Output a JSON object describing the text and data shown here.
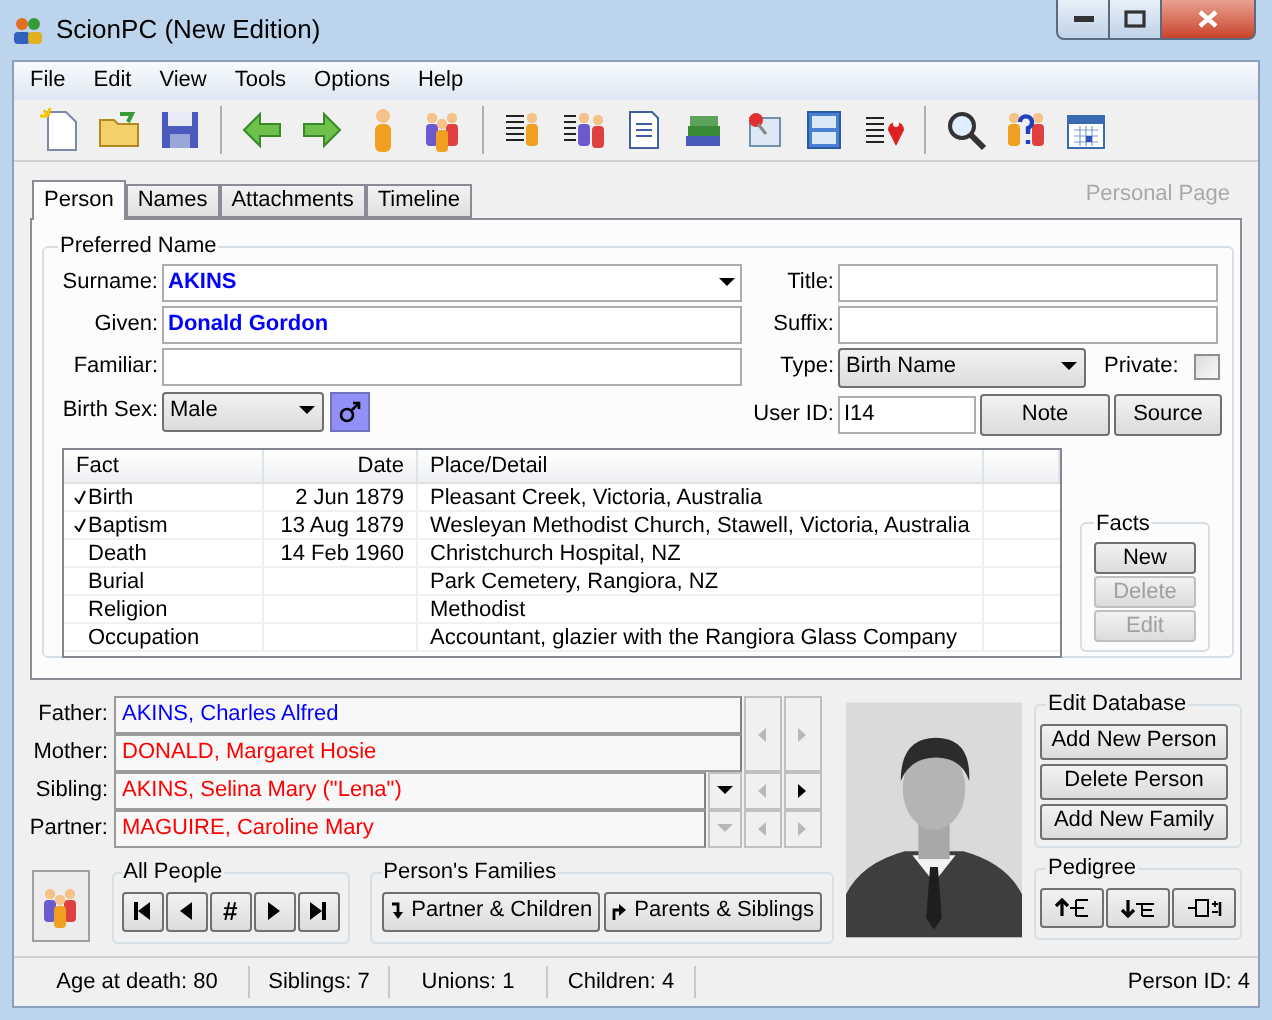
{
  "window": {
    "title": "ScionPC (New Edition)"
  },
  "menu": [
    "File",
    "Edit",
    "View",
    "Tools",
    "Options",
    "Help"
  ],
  "tabs": [
    {
      "label": "Person",
      "selected": true
    },
    {
      "label": "Names",
      "selected": false
    },
    {
      "label": "Attachments",
      "selected": false
    },
    {
      "label": "Timeline",
      "selected": false
    }
  ],
  "page_caption": "Personal Page",
  "preferred_name": {
    "legend": "Preferred Name",
    "surname": {
      "label": "Surname:",
      "value": "AKINS"
    },
    "given": {
      "label": "Given:",
      "value": "Donald Gordon"
    },
    "familiar": {
      "label": "Familiar:"
    },
    "title": {
      "label": "Title:"
    },
    "suffix": {
      "label": "Suffix:"
    },
    "type": {
      "label": "Type:",
      "value": "Birth Name"
    },
    "private": {
      "label": "Private:",
      "checked": false
    },
    "birth_sex": {
      "label": "Birth Sex:",
      "value": "Male"
    },
    "user_id": {
      "label": "User ID:",
      "value": "I14"
    },
    "note_button": "Note",
    "source_button": "Source"
  },
  "facts_table": {
    "columns": [
      "Fact",
      "Date",
      "Place/Detail"
    ],
    "rows": [
      {
        "fact": "Birth",
        "date": "2 Jun 1879",
        "place": "Pleasant Creek, Victoria, Australia",
        "checked": true
      },
      {
        "fact": "Baptism",
        "date": "13 Aug 1879",
        "place": "Wesleyan Methodist Church, Stawell, Victoria, Australia",
        "checked": true
      },
      {
        "fact": "Death",
        "date": "14 Feb 1960",
        "place": "Christchurch Hospital, NZ",
        "checked": false
      },
      {
        "fact": "Burial",
        "place": "Park Cemetery, Rangiora, NZ",
        "checked": false
      },
      {
        "fact": "Religion",
        "place": "Methodist",
        "checked": false
      },
      {
        "fact": "Occupation",
        "place": "Accountant, glazier with the Rangiora Glass Company",
        "checked": false
      }
    ]
  },
  "facts_group": {
    "legend": "Facts",
    "buttons": [
      {
        "label": "New",
        "disabled": false
      },
      {
        "label": "Delete",
        "disabled": true
      },
      {
        "label": "Edit",
        "disabled": true
      }
    ]
  },
  "relatives": [
    {
      "kind": "parent",
      "label": "Father:",
      "name": "AKINS, Charles Alfred",
      "color": "#0000ff"
    },
    {
      "kind": "parent",
      "label": "Mother:",
      "name": "DONALD, Margaret Hosie",
      "color": "#ff0000"
    },
    {
      "kind": "browse",
      "label": "Sibling:",
      "name": "AKINS, Selina Mary (\"Lena\")",
      "color": "#ff0000",
      "dropdown_disabled": false,
      "prev_disabled": true,
      "next_disabled": false
    },
    {
      "kind": "browse",
      "label": "Partner:",
      "name": "MAGUIRE, Caroline Mary",
      "color": "#ff0000",
      "dropdown_disabled": true,
      "prev_disabled": true,
      "next_disabled": true
    }
  ],
  "parents_nav": {
    "prev_disabled": true,
    "next_disabled": true
  },
  "all_people": {
    "legend": "All People",
    "index_button": "#"
  },
  "persons_families": {
    "legend": "Person's Families",
    "buttons": [
      "Partner & Children",
      "Parents & Siblings"
    ]
  },
  "edit_database": {
    "legend": "Edit Database",
    "buttons": [
      "Add New Person",
      "Delete Person",
      "Add New Family"
    ]
  },
  "pedigree": {
    "legend": "Pedigree"
  },
  "status_bar": {
    "fields": [
      "Age at death: 80",
      "Siblings: 7",
      "Unions: 1",
      "Children: 4"
    ],
    "person_id": "Person ID: 4"
  }
}
